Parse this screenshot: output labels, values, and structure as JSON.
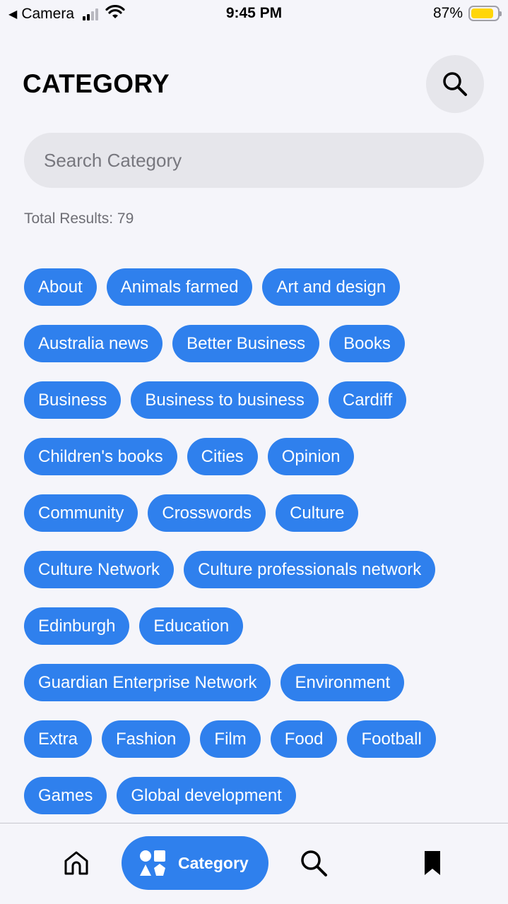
{
  "status_bar": {
    "back_app": "Camera",
    "time": "9:45 PM",
    "battery_percent": "87%",
    "battery_level": 0.87,
    "battery_color": "#ffd60a"
  },
  "header": {
    "title": "CATEGORY",
    "search_icon": "search-icon"
  },
  "search": {
    "placeholder": "Search Category",
    "value": ""
  },
  "results": {
    "total_label": "Total Results: 79"
  },
  "categories": [
    "About",
    "Animals farmed",
    "Art and design",
    "Australia news",
    "Better Business",
    "Books",
    "Business",
    "Business to business",
    "Cardiff",
    "Children's books",
    "Cities",
    "Opinion",
    "Community",
    "Crosswords",
    "Culture",
    "Culture Network",
    "Culture professionals network",
    "Edinburgh",
    "Education",
    "Guardian Enterprise Network",
    "Environment",
    "Extra",
    "Fashion",
    "Film",
    "Food",
    "Football",
    "Games",
    "Global development"
  ],
  "bottom_nav": {
    "home_icon": "home-icon",
    "category_label": "Category",
    "category_icon": "shapes-icon",
    "search_icon": "search-icon",
    "bookmark_icon": "bookmark-icon",
    "active": "Category"
  },
  "colors": {
    "accent": "#2f80ed",
    "background": "#f5f5fa",
    "surface": "#e6e6eb"
  }
}
